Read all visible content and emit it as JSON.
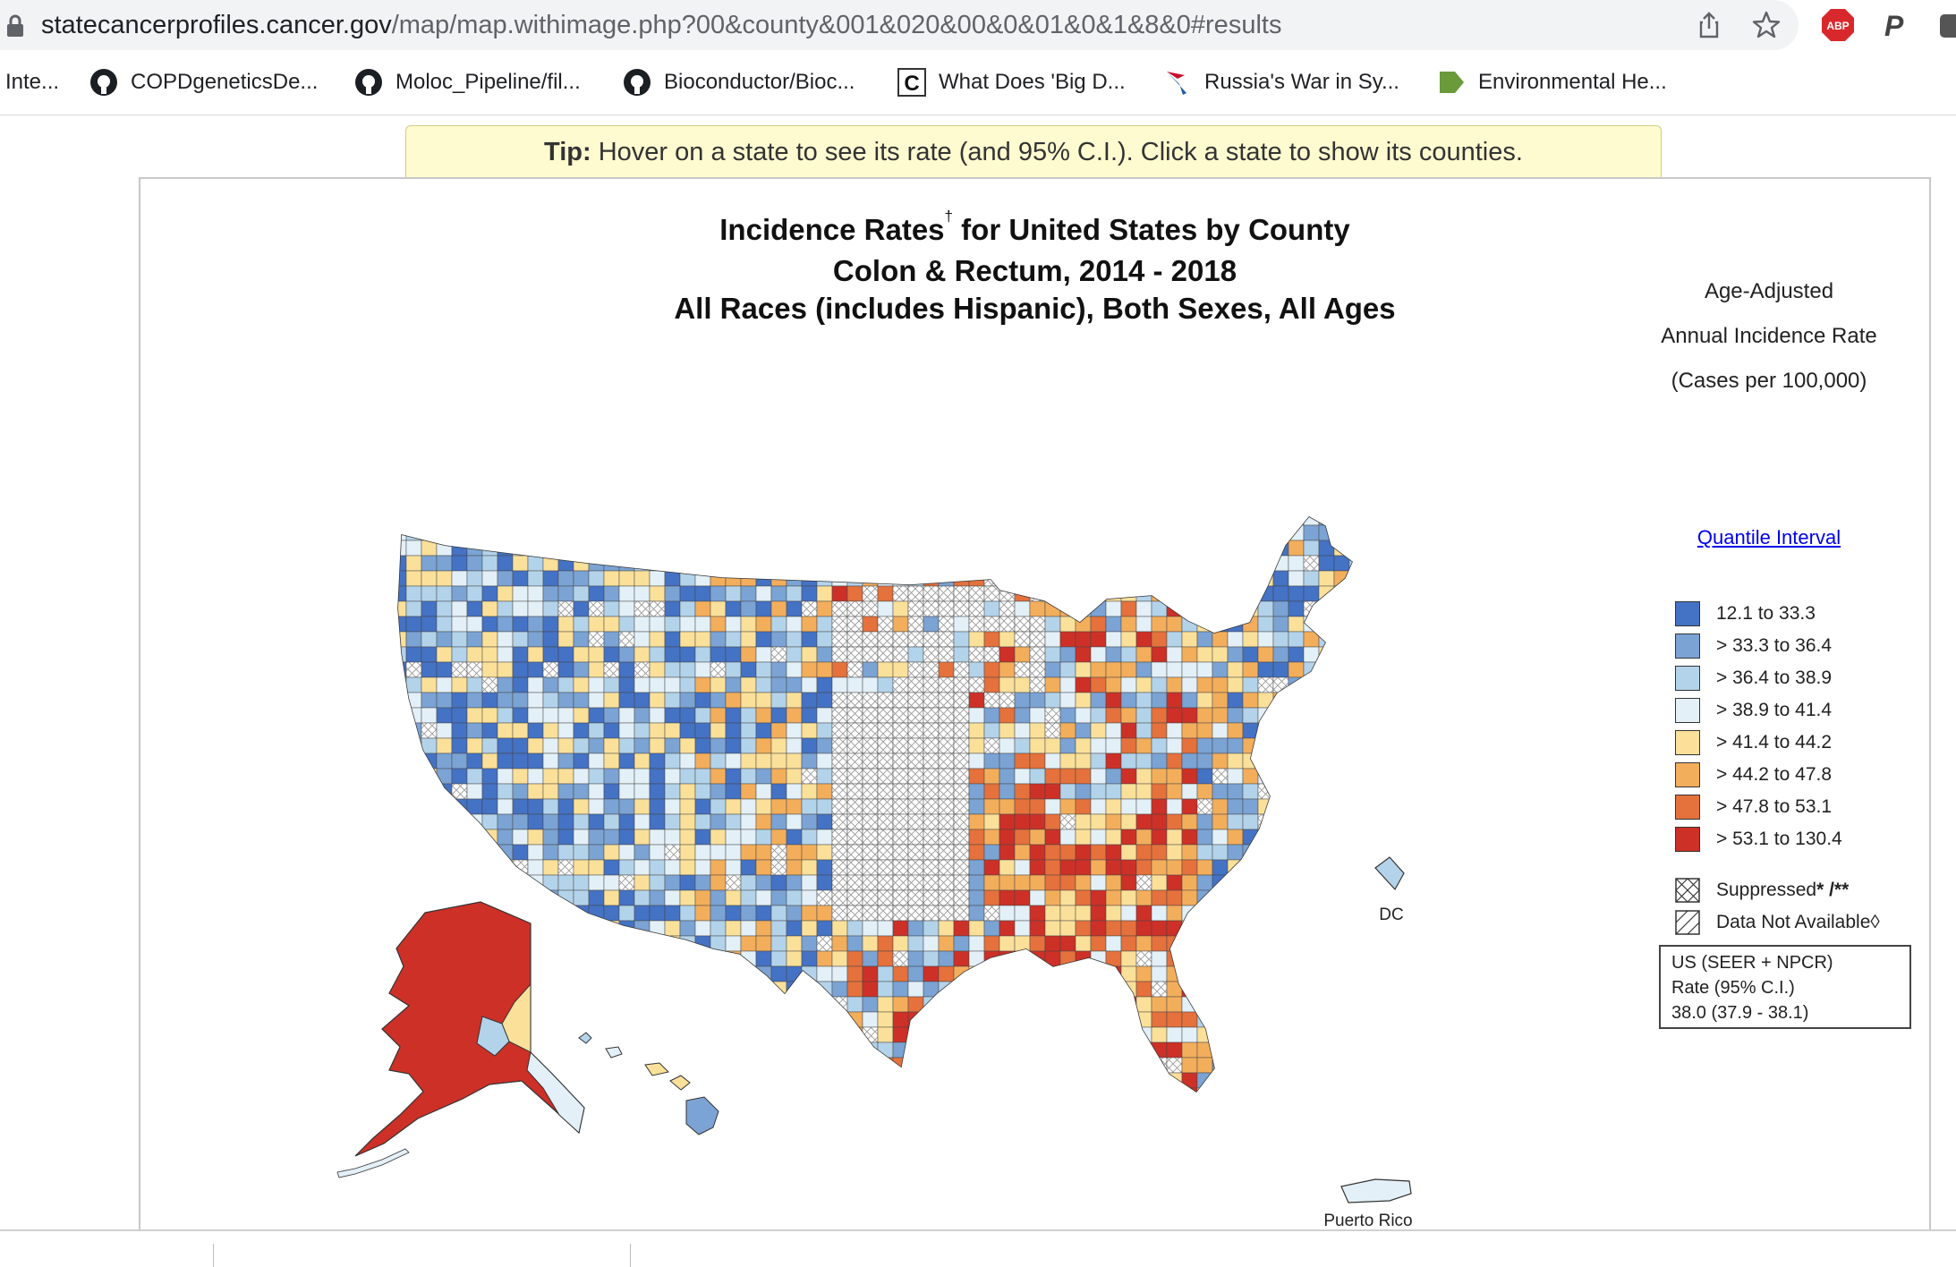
{
  "browser": {
    "url_host": "statecancerprofiles.cancer.gov",
    "url_path": "/map/map.withimage.php?00&county&001&020&00&0&01&0&1&8&0#results",
    "icons": [
      "lock-icon",
      "share-icon",
      "star-icon",
      "adblock-icon",
      "p-extension-icon",
      "extension-icon"
    ],
    "abp_label": "ABP",
    "p_label": "P"
  },
  "bookmarks": [
    {
      "label": "Inte...",
      "icon": "none"
    },
    {
      "label": "COPDgeneticsDe...",
      "icon": "github-icon"
    },
    {
      "label": "Moloc_Pipeline/fil...",
      "icon": "github-icon"
    },
    {
      "label": "Bioconductor/Bioc...",
      "icon": "github-icon"
    },
    {
      "label": "What Does 'Big D...",
      "icon": "c-icon"
    },
    {
      "label": "Russia's War in Sy...",
      "icon": "airline-icon"
    },
    {
      "label": "Environmental He...",
      "icon": "arrow-icon"
    }
  ],
  "tip": {
    "bold": "Tip:",
    "text": " Hover on a state to see its rate (and 95% C.I.).  Click a state to show its counties."
  },
  "map": {
    "title_line1": "Incidence Rates",
    "title_dagger": "†",
    "title_line1_rest": " for United States by County",
    "title_line2": "Colon & Rectum, 2014 - 2018",
    "title_line3": "All Races (includes Hispanic), Both Sexes, All Ages",
    "label_dc": "DC",
    "label_pr": "Puerto Rico"
  },
  "legend": {
    "heading1": "Age-Adjusted",
    "heading2": "Annual Incidence Rate",
    "heading3": "(Cases per 100,000)",
    "link": "Quantile Interval",
    "bins": [
      {
        "label": "12.1  to  33.3",
        "color": "#4472c4"
      },
      {
        "label": "> 33.3  to  36.4",
        "color": "#7ba3d4"
      },
      {
        "label": "> 36.4  to  38.9",
        "color": "#b3d3ea"
      },
      {
        "label": "> 38.9  to  41.4",
        "color": "#e3f0f8"
      },
      {
        "label": "> 41.4  to  44.2",
        "color": "#fbe09a"
      },
      {
        "label": "> 44.2  to  47.8",
        "color": "#f3ae5c"
      },
      {
        "label": "> 47.8  to  53.1",
        "color": "#e5713c"
      },
      {
        "label": "> 53.1  to  130.4",
        "color": "#cd3027"
      }
    ],
    "suppressed": "Suppressed",
    "suppressed_mark": " * /**",
    "not_available": "Data Not Available",
    "not_available_mark": " ◊",
    "us_line1": "US (SEER + NPCR)",
    "us_line2": "Rate (95% C.I.)",
    "us_line3": "38.0 (37.9 - 38.1)"
  }
}
